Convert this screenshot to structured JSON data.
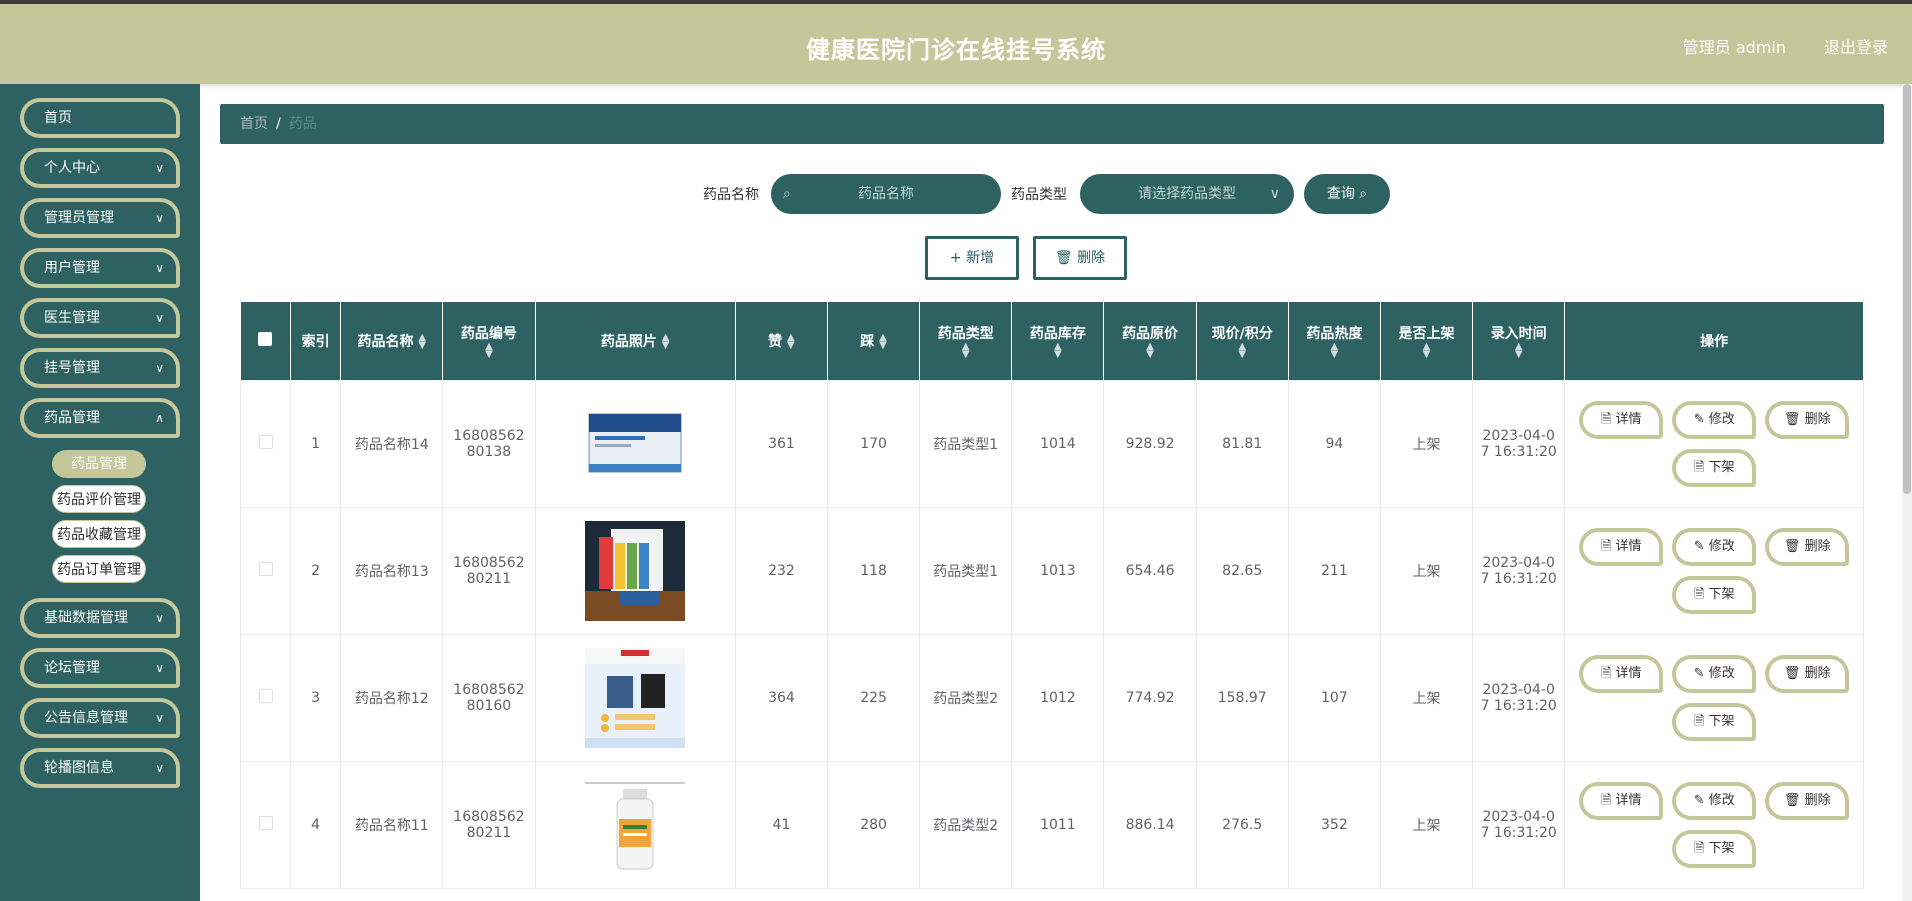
{
  "header": {
    "title": "健康医院门诊在线挂号系统",
    "admin": "管理员 admin",
    "logout": "退出登录"
  },
  "sidebar": {
    "items": [
      {
        "label": "首页",
        "has_arrow": false
      },
      {
        "label": "个人中心",
        "has_arrow": true
      },
      {
        "label": "管理员管理",
        "has_arrow": true
      },
      {
        "label": "用户管理",
        "has_arrow": true
      },
      {
        "label": "医生管理",
        "has_arrow": true
      },
      {
        "label": "挂号管理",
        "has_arrow": true
      },
      {
        "label": "药品管理",
        "has_arrow": true
      },
      {
        "label": "基础数据管理",
        "has_arrow": true
      },
      {
        "label": "论坛管理",
        "has_arrow": true
      },
      {
        "label": "公告信息管理",
        "has_arrow": true
      },
      {
        "label": "轮播图信息",
        "has_arrow": true
      }
    ],
    "submenu": [
      "药品管理",
      "药品评价管理",
      "药品收藏管理",
      "药品订单管理"
    ],
    "active_submenu": "药品管理"
  },
  "breadcrumb": {
    "home": "首页",
    "sep": "/",
    "current": "药品"
  },
  "search": {
    "name_label": "药品名称",
    "name_placeholder": "药品名称",
    "type_label": "药品类型",
    "type_placeholder": "请选择药品类型",
    "query": "查询"
  },
  "actions": {
    "add": "新增",
    "delete": "删除"
  },
  "table": {
    "headers": [
      "索引",
      "药品名称",
      "药品编号",
      "药品照片",
      "赞",
      "踩",
      "药品类型",
      "药品库存",
      "药品原价",
      "现价/积分",
      "药品热度",
      "是否上架",
      "录入时间",
      "操作"
    ],
    "rows": [
      {
        "index": "1",
        "name": "药品名称14",
        "code_a": "16808562",
        "code_b": "80138",
        "like": "361",
        "dislike": "170",
        "type": "药品类型1",
        "stock": "1014",
        "price": "928.92",
        "now": "81.81",
        "hot": "94",
        "onsale": "上架",
        "time_a": "2023-04-0",
        "time_b": "7 16:31:20"
      },
      {
        "index": "2",
        "name": "药品名称13",
        "code_a": "16808562",
        "code_b": "80211",
        "like": "232",
        "dislike": "118",
        "type": "药品类型1",
        "stock": "1013",
        "price": "654.46",
        "now": "82.65",
        "hot": "211",
        "onsale": "上架",
        "time_a": "2023-04-0",
        "time_b": "7 16:31:20"
      },
      {
        "index": "3",
        "name": "药品名称12",
        "code_a": "16808562",
        "code_b": "80160",
        "like": "364",
        "dislike": "225",
        "type": "药品类型2",
        "stock": "1012",
        "price": "774.92",
        "now": "158.97",
        "hot": "107",
        "onsale": "上架",
        "time_a": "2023-04-0",
        "time_b": "7 16:31:20"
      },
      {
        "index": "4",
        "name": "药品名称11",
        "code_a": "16808562",
        "code_b": "80211",
        "like": "41",
        "dislike": "280",
        "type": "药品类型2",
        "stock": "1011",
        "price": "886.14",
        "now": "276.5",
        "hot": "352",
        "onsale": "上架",
        "time_a": "2023-04-0",
        "time_b": "7 16:31:20"
      }
    ],
    "ops": {
      "detail": "详情",
      "edit": "修改",
      "delete": "删除",
      "offshelf": "下架"
    }
  },
  "colors": {
    "primary": "#2e6262",
    "accent": "#c4c79a"
  }
}
